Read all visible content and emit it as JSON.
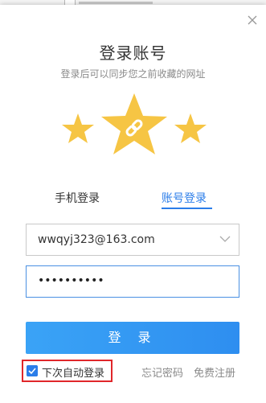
{
  "dialog": {
    "title": "登录账号",
    "subtitle": "登录后可以同步您之前收藏的网址"
  },
  "icons": {
    "close": "close-icon",
    "stars": "three-stars-link-icon",
    "dropdown": "chevron-down-icon",
    "checkbox": "checkmark-icon"
  },
  "tabs": [
    {
      "label": "手机登录",
      "active": false
    },
    {
      "label": "账号登录",
      "active": true
    }
  ],
  "form": {
    "username_value": "wwqyj323@163.com",
    "password_mask": "••••••••••",
    "login_label": "登 录"
  },
  "options": {
    "auto_login_label": "下次自动登录",
    "auto_login_checked": true,
    "forgot_password": "忘记密码",
    "register": "免费注册"
  },
  "colors": {
    "accent": "#2b7de9",
    "button": "#3399f3",
    "star": "#f6c544",
    "highlight": "#e0262a"
  }
}
